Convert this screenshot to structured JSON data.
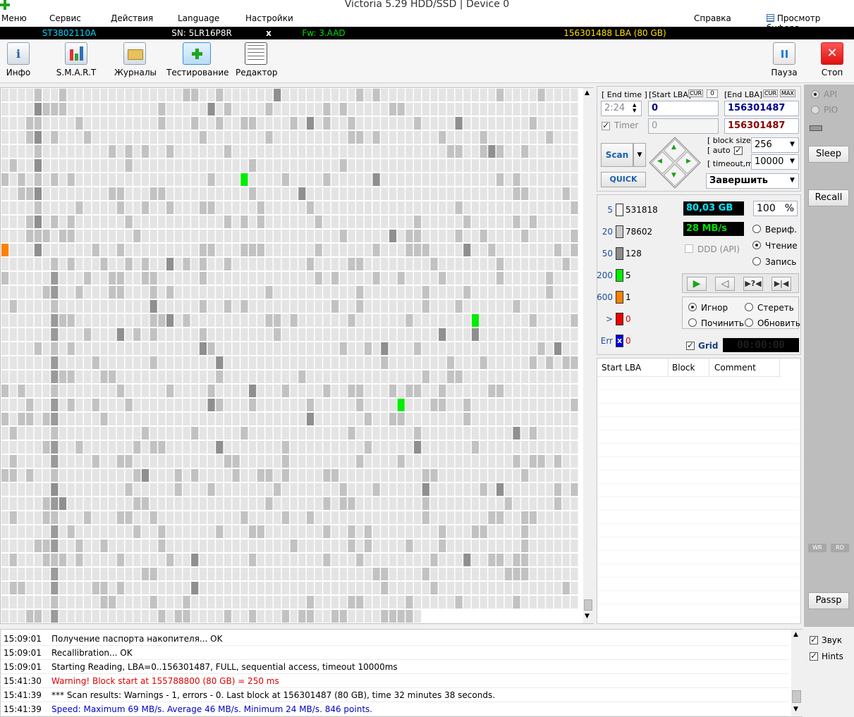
{
  "window": {
    "title": "Victoria 5.29 HDD/SSD | Device 0"
  },
  "menu": {
    "items": [
      "Меню",
      "Сервис",
      "Действия",
      "Language",
      "Настройки"
    ],
    "help": "Справка",
    "clipboard": "Просмотр буфера"
  },
  "device": {
    "model": "ST3802110A",
    "serial": "SN: 5LR16P8R",
    "close": "x",
    "firmware": "Fw: 3.AAD",
    "capacity": "156301488 LBA (80 GB)"
  },
  "toolbar": {
    "info": "Инфо",
    "smart": "S.M.A.R.T",
    "logs": "Журналы",
    "testing": "Тестирование",
    "editor": "Редактор",
    "pause": "Пауза",
    "stop": "Стоп"
  },
  "scan": {
    "end_time_label": "[ End time ]",
    "end_time": "2:24",
    "start_lba_label": "[Start LBA]",
    "cur_label": "CUR",
    "cur_value": "0",
    "start_lba": "0",
    "end_lba_label": "[End LBA]",
    "max_label": "MAX",
    "end_lba": "156301487",
    "timer_label": "Timer",
    "timer_value": "0",
    "current_lba": "156301487",
    "scan_button": "Scan",
    "quick_button": "QUICK",
    "block_size_label": "[ block size ]",
    "auto_label": "[ auto ]",
    "block_size": "256",
    "timeout_label": "[ timeout,ms ]",
    "timeout": "10000",
    "finish_action": "Завершить"
  },
  "stats": {
    "counts": [
      {
        "label": "5",
        "value": "531818",
        "color": "#f4f4f4"
      },
      {
        "label": "20",
        "value": "78602",
        "color": "#c8c8c8"
      },
      {
        "label": "50",
        "value": "128",
        "color": "#8c8c8c"
      },
      {
        "label": "200",
        "value": "5",
        "color": "#00ee00"
      },
      {
        "label": "600",
        "value": "1",
        "color": "#ff8000"
      },
      {
        "label": ">",
        "value": "0",
        "color": "#ee0000"
      },
      {
        "label": "Err",
        "value": "0",
        "color": "#0000ee"
      }
    ],
    "err_mark": "x",
    "size_done": "80,03 GB",
    "percent": "100",
    "percent_unit": "%",
    "speed": "28 MB/s",
    "ddd_label": "DDD (API)",
    "mode_verify": "Вериф.",
    "mode_read": "Чтение",
    "mode_write": "Запись",
    "action_ignore": "Игнор",
    "action_erase": "Стереть",
    "action_fix": "Починить",
    "action_refresh": "Обновить",
    "grid_label": "Grid",
    "grid_timer": "00:00:00"
  },
  "table": {
    "columns": [
      "Start LBA",
      "Block",
      "Comment"
    ]
  },
  "sidebar": {
    "api": "API",
    "pio": "PIO",
    "sleep": "Sleep",
    "recall": "Recall",
    "wr": "WR",
    "rd": "RD",
    "passp": "Passp",
    "sound": "Звук",
    "hints": "Hints"
  },
  "log": [
    {
      "time": "15:09:01",
      "msg": "Получение паспорта накопителя... OK",
      "color": "#000000"
    },
    {
      "time": "15:09:01",
      "msg": "Recallibration... OK",
      "color": "#000000"
    },
    {
      "time": "15:09:01",
      "msg": "Starting Reading, LBA=0..156301487, FULL, sequential access, timeout 10000ms",
      "color": "#000000"
    },
    {
      "time": "15:41:30",
      "msg": "Warning! Block start at 155788800 (80 GB)  = 250 ms",
      "color": "#e00000"
    },
    {
      "time": "15:41:39",
      "msg": "*** Scan results: Warnings - 1, errors - 0. Last block at 156301487 (80 GB), time 32 minutes 38 seconds.",
      "color": "#000000"
    },
    {
      "time": "15:41:39",
      "msg": "Speed: Maximum 69 MB/s. Average 46 MB/s. Minimum 24 MB/s. 846 points.",
      "color": "#0000cc"
    }
  ],
  "colors": {
    "model": "#00d8ff",
    "firmware": "#00e000",
    "capacity": "#ffe000",
    "size_done": "#00e8ff",
    "speed": "#00e000"
  }
}
